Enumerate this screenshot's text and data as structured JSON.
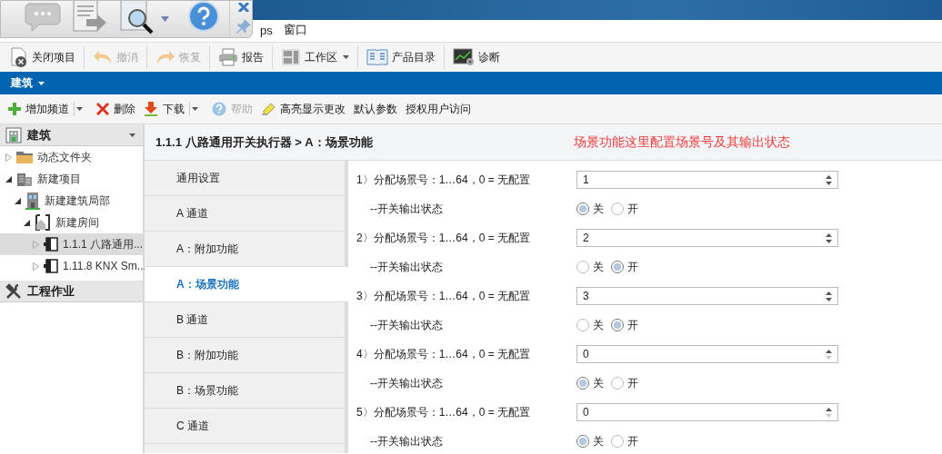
{
  "menu_bar": {
    "items": [
      "ps",
      "窗口"
    ]
  },
  "toolbar": {
    "items": [
      {
        "kind": "close-project",
        "label": "关闭项目",
        "disabled": false,
        "dropdown": false
      },
      {
        "kind": "undo",
        "label": "撤消",
        "disabled": true,
        "dropdown": false
      },
      {
        "kind": "redo",
        "label": "恢复",
        "disabled": true,
        "dropdown": false
      },
      {
        "kind": "report",
        "label": "报告",
        "disabled": false,
        "dropdown": false
      },
      {
        "kind": "workspace",
        "label": "工作区",
        "disabled": false,
        "dropdown": true
      },
      {
        "kind": "catalog",
        "label": "产品目录",
        "disabled": false,
        "dropdown": false
      },
      {
        "kind": "diagnose",
        "label": "诊断",
        "disabled": false,
        "dropdown": false
      }
    ]
  },
  "panel_bar": {
    "title": "建筑"
  },
  "actions": {
    "items": [
      {
        "kind": "add",
        "label": "增加频道",
        "disabled": false,
        "split": true
      },
      {
        "kind": "delete",
        "label": "删除",
        "disabled": false,
        "split": false
      },
      {
        "kind": "download",
        "label": "下载",
        "disabled": false,
        "split": true
      },
      {
        "kind": "help",
        "label": "帮助",
        "disabled": true,
        "split": false
      },
      {
        "kind": "highlight",
        "label": "高亮显示更改",
        "disabled": false,
        "split": false
      },
      {
        "kind": "text",
        "label": "默认参数",
        "disabled": false,
        "split": false
      },
      {
        "kind": "text",
        "label": "授权用户访问",
        "disabled": false,
        "split": false
      }
    ]
  },
  "sidebar": {
    "header": "建筑",
    "tree": [
      {
        "kind": "folder",
        "label": "动态文件夹",
        "expanded": false,
        "selected": false
      },
      {
        "kind": "project",
        "label": "新建项目",
        "expanded": true,
        "selected": false,
        "children": [
          {
            "kind": "building",
            "label": "新建建筑局部",
            "expanded": true,
            "selected": false,
            "children": [
              {
                "kind": "room",
                "label": "新建房间",
                "expanded": true,
                "selected": false,
                "children": [
                  {
                    "kind": "device",
                    "label": "1.1.1 八路通用...",
                    "expanded": false,
                    "selected": true
                  },
                  {
                    "kind": "device",
                    "label": "1.11.8 KNX Sm...",
                    "expanded": false,
                    "selected": false
                  }
                ]
              }
            ]
          }
        ]
      }
    ],
    "section": "工程作业"
  },
  "content": {
    "breadcrumb": "1.1.1 八路通用开关执行器 > A：场景功能",
    "annotation": "场景功能这里配置场景号及其输出状态",
    "nav": [
      {
        "label": "通用设置",
        "selected": false
      },
      {
        "label": "A 通道",
        "selected": false
      },
      {
        "label": "A：附加功能",
        "selected": false
      },
      {
        "label": "A：场景功能",
        "selected": true
      },
      {
        "label": "B 通道",
        "selected": false
      },
      {
        "label": "B：附加功能",
        "selected": false
      },
      {
        "label": "B：场景功能",
        "selected": false
      },
      {
        "label": "C 通道",
        "selected": false
      }
    ],
    "params": [
      {
        "label": "1〉分配场景号：1…64，0 = 无配置",
        "value": "1",
        "down_disabled": false,
        "state_label": "--开关输出状态",
        "options": [
          {
            "label": "关",
            "selected": true
          },
          {
            "label": "开",
            "selected": false
          }
        ]
      },
      {
        "label": "2〉分配场景号：1…64，0 = 无配置",
        "value": "2",
        "down_disabled": false,
        "state_label": "--开关输出状态",
        "options": [
          {
            "label": "关",
            "selected": false
          },
          {
            "label": "开",
            "selected": true
          }
        ]
      },
      {
        "label": "3〉分配场景号：1…64，0 = 无配置",
        "value": "3",
        "down_disabled": false,
        "state_label": "--开关输出状态",
        "options": [
          {
            "label": "关",
            "selected": false
          },
          {
            "label": "开",
            "selected": true
          }
        ]
      },
      {
        "label": "4〉分配场景号：1…64，0 = 无配置",
        "value": "0",
        "down_disabled": true,
        "state_label": "--开关输出状态",
        "options": [
          {
            "label": "关",
            "selected": true
          },
          {
            "label": "开",
            "selected": false
          }
        ]
      },
      {
        "label": "5〉分配场景号：1…64，0 = 无配置",
        "value": "0",
        "down_disabled": true,
        "state_label": "--开关输出状态",
        "options": [
          {
            "label": "关",
            "selected": true
          },
          {
            "label": "开",
            "selected": false
          }
        ]
      }
    ]
  }
}
